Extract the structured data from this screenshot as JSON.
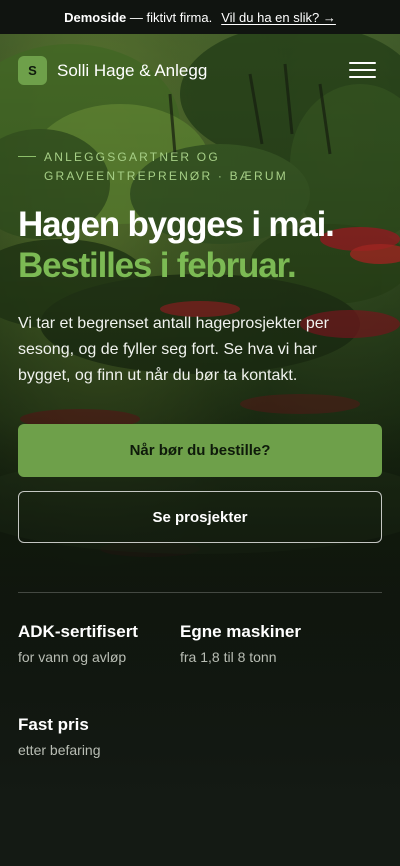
{
  "announcement": {
    "brand": "Demoside",
    "text": "— fiktivt firma.",
    "link": "Vil du ha en slik? →"
  },
  "header": {
    "logo_letter": "S",
    "company_name": "Solli Hage & Anlegg",
    "menu_icon": "hamburger-menu-icon"
  },
  "hero": {
    "eyebrow": "ANLEGGSGARTNER OG GRAVEENTREPRENØR · BÆRUM",
    "title_line1": "Hagen bygges i mai.",
    "title_line2": "Bestilles i februar.",
    "lead": "Vi tar et begrenset antall hageprosjekter per sesong, og de fyller seg fort. Se hva vi har bygget, og finn ut når du bør ta kontakt.",
    "cta_primary": "Når bør du bestille?",
    "cta_secondary": "Se prosjekter"
  },
  "features": [
    {
      "title": "ADK-sertifisert",
      "subtitle": "for vann og avløp"
    },
    {
      "title": "Egne maskiner",
      "subtitle": "fra 1,8 til 8 tonn"
    },
    {
      "title": "Fast pris",
      "subtitle": "etter befaring"
    }
  ],
  "colors": {
    "accent": "#6ea04a",
    "accent_text": "#7cba54",
    "background": "#141a14"
  }
}
